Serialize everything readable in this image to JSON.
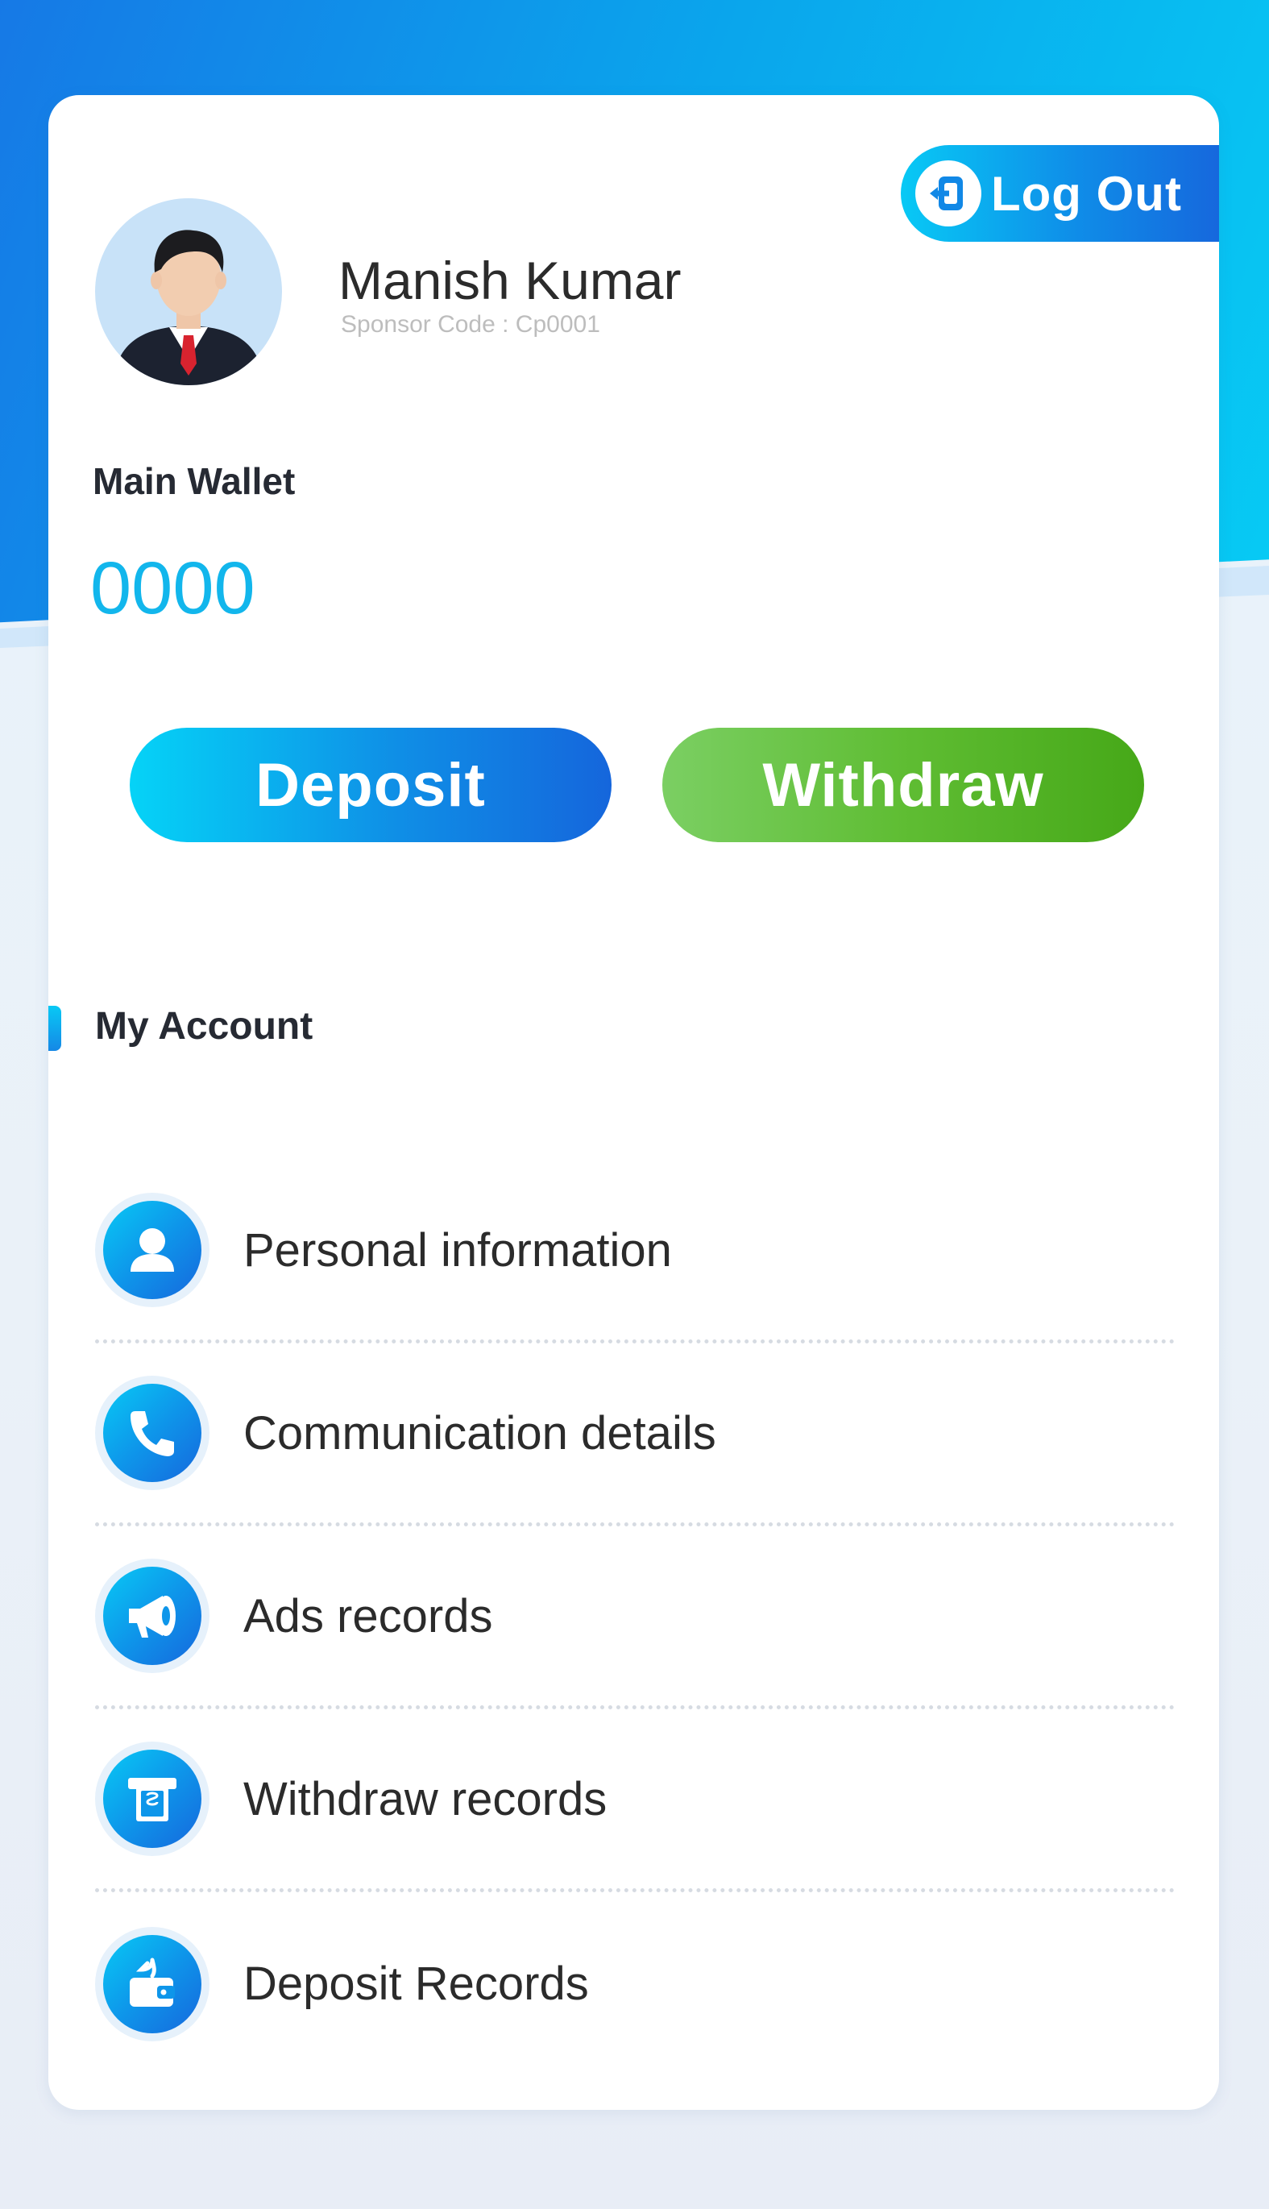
{
  "header": {
    "logout_label": "Log Out"
  },
  "profile": {
    "name": "Manish Kumar",
    "sponsor_code": "Sponsor Code : Cp0001"
  },
  "wallet": {
    "label": "Main Wallet",
    "amount": "0000"
  },
  "actions": {
    "deposit_label": "Deposit",
    "withdraw_label": "Withdraw"
  },
  "account": {
    "title": "My Account",
    "items": [
      {
        "label": "Personal information",
        "icon": "user-icon"
      },
      {
        "label": "Communication details",
        "icon": "phone-icon"
      },
      {
        "label": "Ads records",
        "icon": "megaphone-icon"
      },
      {
        "label": "Withdraw records",
        "icon": "atm-withdraw-icon"
      },
      {
        "label": "Deposit Records",
        "icon": "wallet-deposit-icon"
      }
    ]
  },
  "colors": {
    "accent_blue": "#0f8de8",
    "accent_cyan": "#08c9f5",
    "accent_green": "#5fbd33",
    "amount_color": "#12b6ec"
  }
}
